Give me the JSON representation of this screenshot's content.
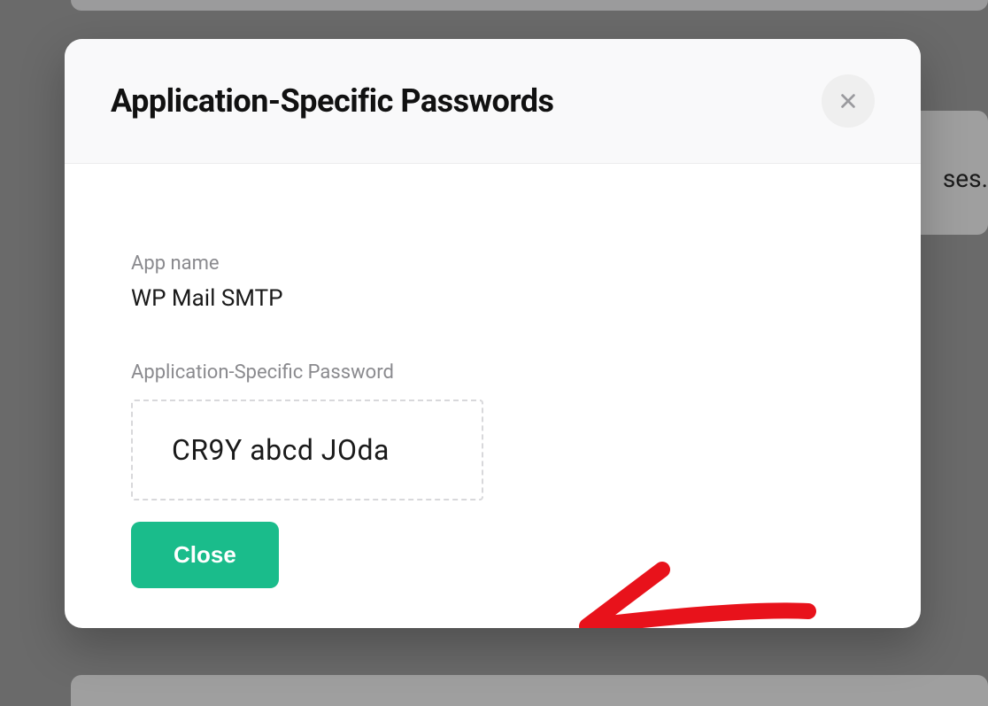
{
  "background": {
    "partial_text": "ses."
  },
  "modal": {
    "title": "Application-Specific Passwords",
    "app_name_label": "App name",
    "app_name_value": "WP Mail SMTP",
    "password_label": "Application-Specific Password",
    "password_value": "CR9Y abcd JOda",
    "close_button_label": "Close"
  }
}
